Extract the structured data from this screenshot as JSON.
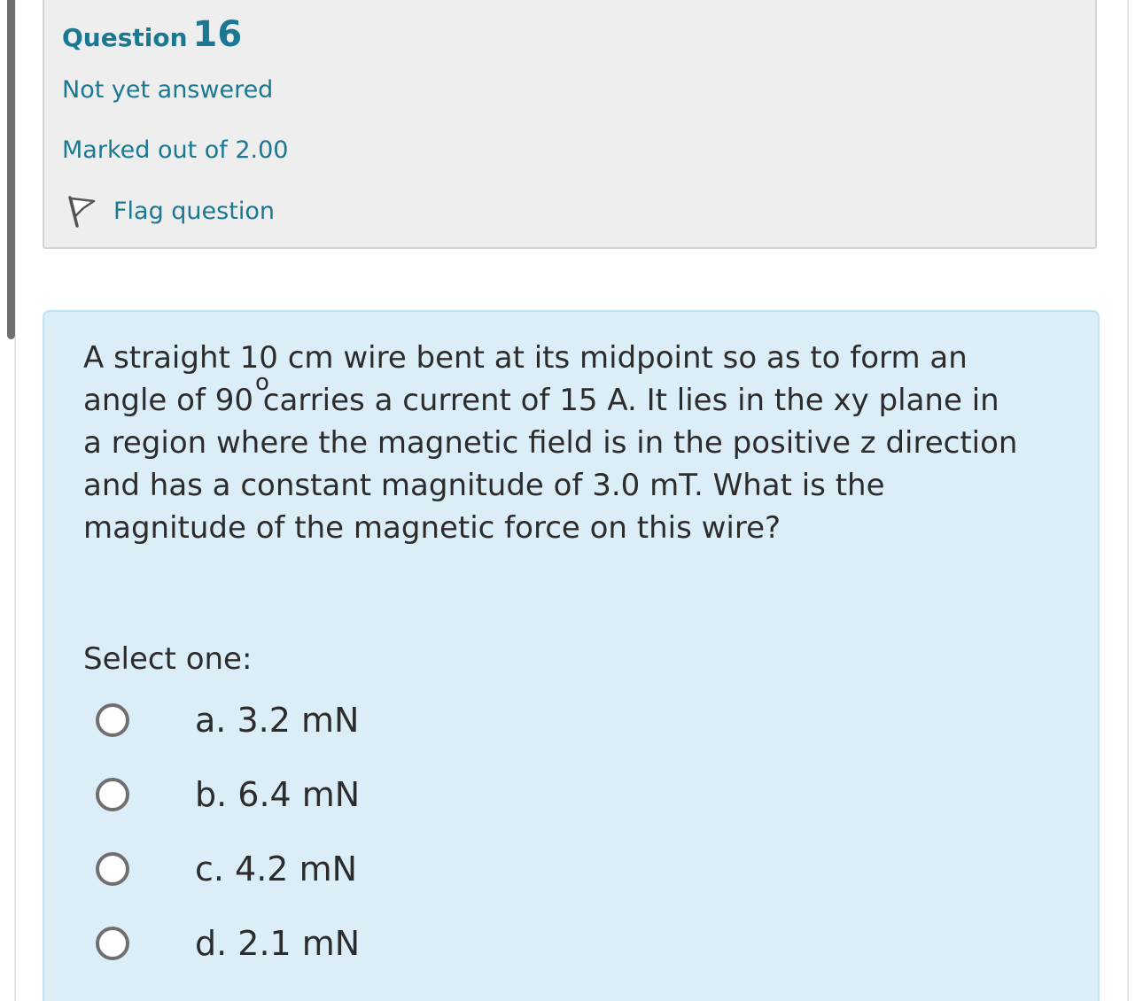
{
  "info": {
    "question_word": "Question",
    "question_number": "16",
    "state": "Not yet answered",
    "grade": "Marked out of 2.00",
    "flag_label": "Flag question"
  },
  "question": {
    "text_part1": "A straight 10 cm wire bent at its midpoint so as to form an angle of 90",
    "degree_mark": "o",
    "text_part2": " carries a current of 15 A. It lies in the xy plane in a region where the magnetic field is in the positive z direction and has a constant magnitude of 3.0 mT. What is the magnitude of the magnetic force on this wire?",
    "prompt": "Select one:",
    "options": [
      {
        "label": "a. 3.2 mN"
      },
      {
        "label": "b. 6.4 mN"
      },
      {
        "label": "c. 4.2 mN"
      },
      {
        "label": "d. 2.1 mN"
      }
    ]
  },
  "colors": {
    "link": "#1a7892",
    "info_bg": "#eeeeee",
    "content_bg": "#dbedf7",
    "content_border": "#bfe3f2"
  }
}
